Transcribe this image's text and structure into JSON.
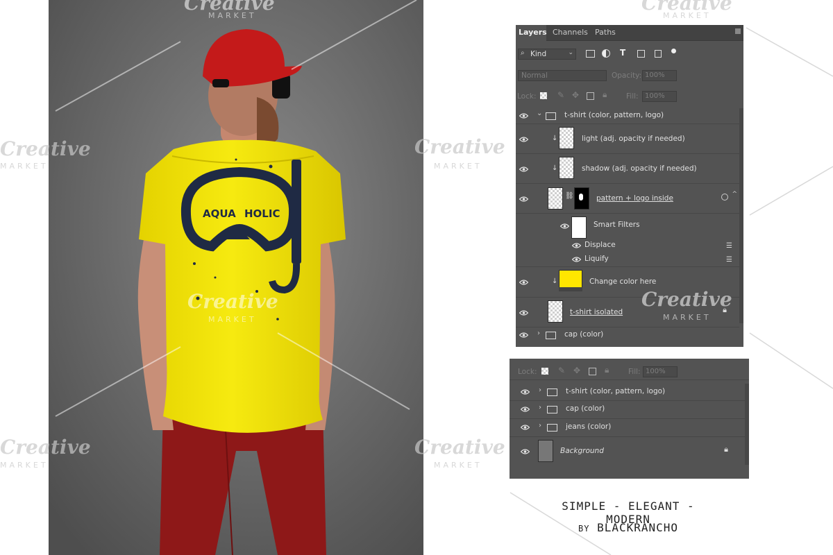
{
  "panel_main": {
    "tabs": [
      "Layers",
      "Channels",
      "Paths"
    ],
    "filter_kind": "Kind",
    "blend_mode": "Normal",
    "opacity_label": "Opacity:",
    "opacity_value": "100%",
    "lock_label": "Lock:",
    "fill_label": "Fill:",
    "fill_value": "100%",
    "layers": {
      "group_tshirt": "t-shirt (color, pattern, logo)",
      "light": "light (adj. opacity if needed)",
      "shadow": "shadow (adj. opacity if needed)",
      "pattern": "pattern + logo inside",
      "smart_filters": "Smart Filters",
      "displace": "Displace",
      "liquify": "Liquify",
      "change_color": "Change color here",
      "tshirt_isolated": "t-shirt isolated",
      "group_cap": "cap (color)"
    }
  },
  "panel_secondary": {
    "lock_label": "Lock:",
    "fill_label": "Fill:",
    "fill_value": "100%",
    "layers": {
      "group_tshirt": "t-shirt (color, pattern, logo)",
      "group_cap": "cap (color)",
      "group_jeans": "jeans (color)",
      "background": "Background"
    }
  },
  "shirt_print": {
    "left_text": "AQUA",
    "right_text": "HOLIC"
  },
  "caption": {
    "line1": "SIMPLE - ELEGANT - MODERN",
    "line2_prefix": "BY",
    "line2_name": "BLACKRANCHO"
  },
  "watermark": {
    "word": "Creative",
    "sub": "MARKET"
  },
  "colors": {
    "shirt": "#f2e600",
    "cap": "#c41a1a",
    "jeans": "#8e1818",
    "panel": "#535353",
    "backdrop": "#6e6e6e"
  }
}
